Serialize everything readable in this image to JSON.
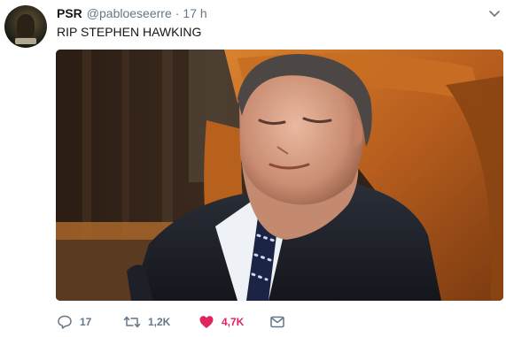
{
  "tweet": {
    "author_name": "PSR",
    "handle": "@pabloeseerre",
    "separator": "·",
    "time": "17 h",
    "text": "RIP STEPHEN HAWKING",
    "actions": {
      "replies": "17",
      "retweets": "1,2K",
      "likes": "4,7K"
    },
    "liked": true
  },
  "colors": {
    "text_primary": "#14171a",
    "text_secondary": "#657786",
    "like_active": "#e0245e"
  },
  "icons": [
    "caret-down-icon",
    "reply-icon",
    "retweet-icon",
    "heart-icon",
    "message-icon"
  ]
}
